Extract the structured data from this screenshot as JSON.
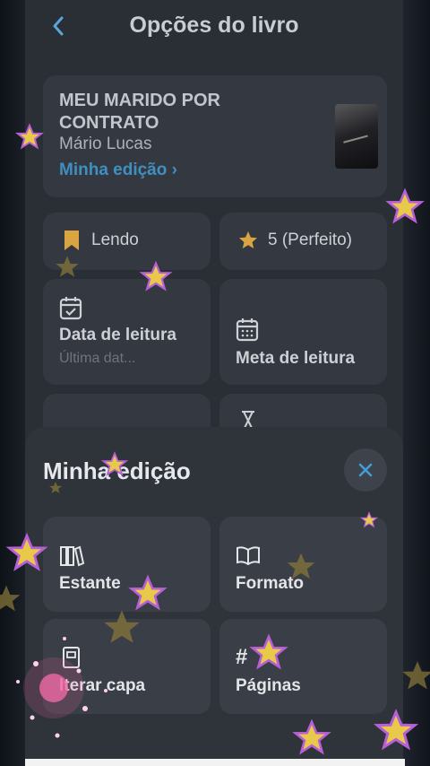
{
  "header": {
    "back_icon": "chevron-left-icon",
    "title": "Opções do livro"
  },
  "book": {
    "title": "MEU MARIDO POR CONTRATO",
    "author": "Mário Lucas",
    "edition_link": "Minha edição ›"
  },
  "options": {
    "status_label": "Lendo",
    "status_icon": "bookmark-icon",
    "rating_label": "5 (Perfeito)",
    "rating_icon": "star-icon",
    "date_label": "Data de leitura",
    "date_sub": "Última dat...",
    "date_icon": "calendar-check-icon",
    "goal_label": "Meta de leitura",
    "goal_icon": "calendar-icon",
    "extra_icon": "hourglass-icon"
  },
  "sheet": {
    "title": "Minha edição",
    "close_icon": "close-icon",
    "items": [
      {
        "label": "Estante",
        "icon": "books-icon"
      },
      {
        "label": "Formato",
        "icon": "open-book-icon"
      },
      {
        "label": "lterar capa",
        "icon": "book-cover-icon"
      },
      {
        "label": "Páginas",
        "icon": "hash-icon"
      }
    ]
  },
  "colors": {
    "accent": "#3f8fc0",
    "star_yellow": "#e8c94a",
    "star_glow": "#b65fd6",
    "card_bg": "#343840",
    "sheet_bg": "#2f333a"
  }
}
